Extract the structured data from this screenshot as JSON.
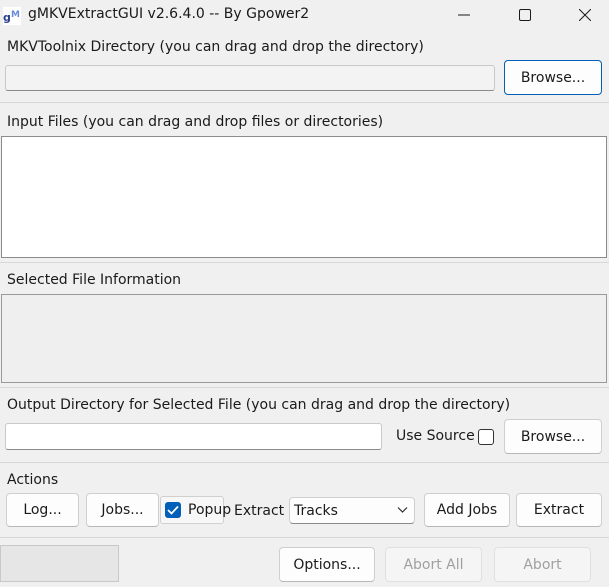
{
  "window": {
    "title": "gMKVExtractGUI v2.6.4.0 -- By Gpower2",
    "icon_name": "app-icon",
    "controls": [
      "minimize-icon",
      "maximize-icon",
      "close-icon"
    ]
  },
  "mkvtoolnix": {
    "label": "MKVToolnix Directory (you can drag and drop the directory)",
    "value": "",
    "browse_label": "Browse..."
  },
  "input": {
    "label": "Input Files (you can drag and drop files or directories)"
  },
  "selected_info": {
    "label": "Selected File Information"
  },
  "output": {
    "label": "Output Directory for Selected File (you can drag and drop the directory)",
    "value": "",
    "use_source_label": "Use Source",
    "use_source_checked": false,
    "browse_label": "Browse..."
  },
  "actions": {
    "label": "Actions",
    "log_label": "Log...",
    "jobs_label": "Jobs...",
    "popup_label": "Popup",
    "popup_checked": true,
    "extract_label": "Extract",
    "extract_mode": "Tracks",
    "add_jobs_label": "Add Jobs",
    "extract_button_label": "Extract"
  },
  "bottom": {
    "options_label": "Options...",
    "abort_all_label": "Abort All",
    "abort_label": "Abort"
  },
  "colors": {
    "accent": "#005fb8",
    "window_bg": "#f0f0f0"
  }
}
